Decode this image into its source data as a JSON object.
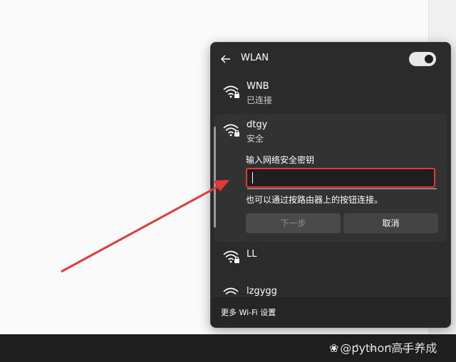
{
  "panel": {
    "title": "WLAN",
    "toggle_on": true
  },
  "networks": [
    {
      "name": "WNB",
      "status": "已连接"
    },
    {
      "name": "dtgy",
      "status": "安全"
    },
    {
      "name": "LL",
      "status": ""
    },
    {
      "name": "lzgygg",
      "status": ""
    }
  ],
  "connect": {
    "password_label": "输入网络安全密钥",
    "password_value": "",
    "hint": "也可以通过按路由器上的按钮连接。",
    "next_label": "下一步",
    "cancel_label": "取消"
  },
  "footer": {
    "settings_link": "更多 Wi-Fi 设置"
  },
  "watermark": {
    "text": "@python高手养成"
  },
  "colors": {
    "panel_bg": "#2b2b2b",
    "highlight": "#e53935",
    "annotation_arrow": "#e53935"
  },
  "icons": [
    "back-arrow-icon",
    "toggle-switch",
    "wifi-secured-icon",
    "wifi-icon",
    "paw-icon"
  ]
}
